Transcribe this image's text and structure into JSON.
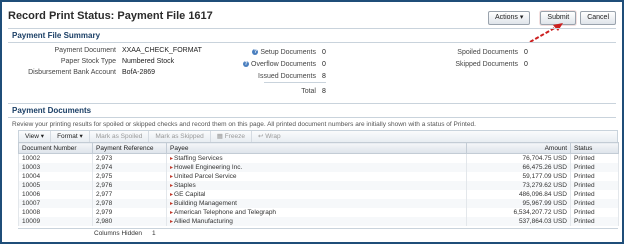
{
  "header": {
    "title": "Record Print Status: Payment File 1617"
  },
  "buttons": {
    "actions": "Actions",
    "submit": "Submit",
    "cancel": "Cancel"
  },
  "summary": {
    "heading": "Payment File Summary",
    "payment_document_label": "Payment Document",
    "payment_document_value": "XXAA_CHECK_FORMAT",
    "paper_stock_label": "Paper Stock Type",
    "paper_stock_value": "Numbered Stock",
    "bank_label": "Disbursement Bank Account",
    "bank_value": "BofA-2869",
    "setup_label": "Setup Documents",
    "setup_value": "0",
    "overflow_label": "Overflow Documents",
    "overflow_value": "0",
    "issued_label": "Issued Documents",
    "issued_value": "8",
    "total_label": "Total",
    "total_value": "8",
    "spoiled_label": "Spoiled Documents",
    "spoiled_value": "0",
    "skipped_label": "Skipped Documents",
    "skipped_value": "0"
  },
  "documents": {
    "heading": "Payment Documents",
    "description": "Review your printing results for spoiled or skipped checks and record them on this page. All printed document numbers are initially shown with a status of Printed.",
    "toolbar": {
      "view": "View",
      "format": "Format",
      "mark_spoiled": "Mark as Spoiled",
      "mark_skipped": "Mark as Skipped",
      "freeze": "Freeze",
      "wrap": "Wrap"
    },
    "columns": {
      "document_number": "Document Number",
      "payment_reference": "Payment Reference",
      "payee": "Payee",
      "amount": "Amount",
      "status": "Status"
    },
    "rows": [
      {
        "doc": "10002",
        "ref": "2,973",
        "payee": "Staffing Services",
        "amount": "76,704.75 USD",
        "status": "Printed"
      },
      {
        "doc": "10003",
        "ref": "2,974",
        "payee": "Howell Engineering Inc.",
        "amount": "66,475.26 USD",
        "status": "Printed"
      },
      {
        "doc": "10004",
        "ref": "2,975",
        "payee": "United Parcel Service",
        "amount": "59,177.09 USD",
        "status": "Printed"
      },
      {
        "doc": "10005",
        "ref": "2,976",
        "payee": "Staples",
        "amount": "73,279.62 USD",
        "status": "Printed"
      },
      {
        "doc": "10006",
        "ref": "2,977",
        "payee": "GE Capital",
        "amount": "486,096.84 USD",
        "status": "Printed"
      },
      {
        "doc": "10007",
        "ref": "2,978",
        "payee": "Building Management",
        "amount": "95,967.99 USD",
        "status": "Printed"
      },
      {
        "doc": "10008",
        "ref": "2,979",
        "payee": "American Telephone and Telegraph",
        "amount": "6,534,207.72 USD",
        "status": "Printed"
      },
      {
        "doc": "10009",
        "ref": "2,980",
        "payee": "Allied Manufacturing",
        "amount": "537,864.03 USD",
        "status": "Printed"
      }
    ],
    "footer": {
      "columns_hidden_label": "Columns Hidden",
      "columns_hidden_value": "1"
    }
  },
  "colors": {
    "accent": "#1b3f66",
    "arrow": "#cc1f1f",
    "frame": "#1f4e79"
  }
}
